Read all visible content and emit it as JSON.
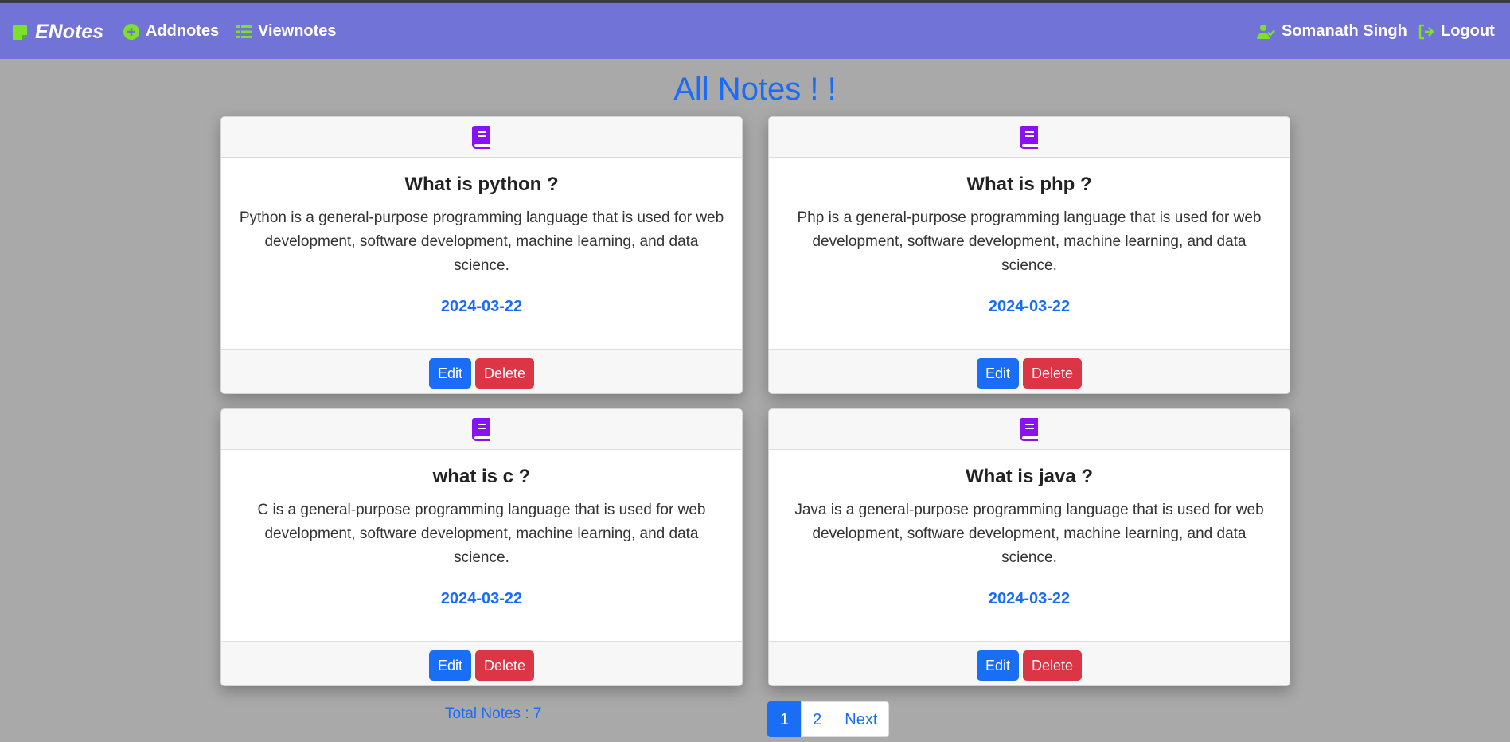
{
  "navbar": {
    "brand": "ENotes",
    "links": [
      {
        "label": "Addnotes",
        "icon": "plus-circle-icon"
      },
      {
        "label": "Viewnotes",
        "icon": "list-icon"
      }
    ],
    "user": {
      "label": "Somanath Singh",
      "icon": "user-icon"
    },
    "logout": {
      "label": "Logout",
      "icon": "logout-icon"
    }
  },
  "page": {
    "title": "All Notes ! !"
  },
  "notes": [
    {
      "title": "What is python ?",
      "body": "Python is a general-purpose programming language that is used for web development, software development, machine learning, and data science.",
      "date": "2024-03-22",
      "edit": "Edit",
      "delete": "Delete"
    },
    {
      "title": "What is php ?",
      "body": "Php is a general-purpose programming language that is used for web development, software development, machine learning, and data science.",
      "date": "2024-03-22",
      "edit": "Edit",
      "delete": "Delete"
    },
    {
      "title": "what is c ?",
      "body": "C is a general-purpose programming language that is used for web development, software development, machine learning, and data science.",
      "date": "2024-03-22",
      "edit": "Edit",
      "delete": "Delete"
    },
    {
      "title": "What is java ?",
      "body": "Java is a general-purpose programming language that is used for web development, software development, machine learning, and data science.",
      "date": "2024-03-22",
      "edit": "Edit",
      "delete": "Delete"
    }
  ],
  "footer": {
    "total": "Total Notes : 7",
    "pagination": {
      "pages": [
        "1",
        "2"
      ],
      "active": "1",
      "next": "Next"
    }
  },
  "colors": {
    "navbar": "#7173d6",
    "accent": "#1a6cf5",
    "danger": "#dc3545",
    "icon_green": "#7ee02a",
    "book_purple": "#8a12f2"
  }
}
